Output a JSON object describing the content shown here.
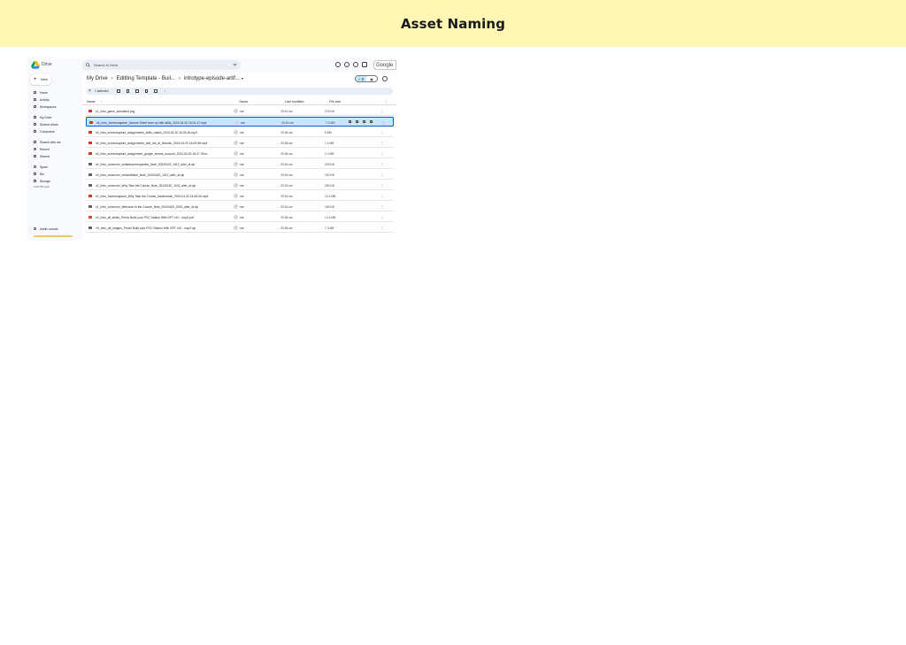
{
  "page": {
    "title": "Asset Naming"
  },
  "drive": {
    "app_name": "Drive",
    "search_placeholder": "Search in Drive",
    "account_label": "Google",
    "new_label": "New",
    "nav": [
      {
        "label": "Home",
        "icon": "home-icon"
      },
      {
        "label": "Activity",
        "icon": "activity-icon"
      },
      {
        "label": "Workspaces",
        "icon": "workspaces-icon"
      },
      {
        "label": "My Drive",
        "icon": "my-drive-icon"
      },
      {
        "label": "Shared drives",
        "icon": "shared-drives-icon"
      },
      {
        "label": "Computers",
        "icon": "computers-icon"
      },
      {
        "label": "Shared with me",
        "icon": "shared-with-me-icon"
      },
      {
        "label": "Recent",
        "icon": "recent-icon"
      },
      {
        "label": "Starred",
        "icon": "starred-icon"
      },
      {
        "label": "Spam",
        "icon": "spam-icon"
      },
      {
        "label": "Bin",
        "icon": "bin-icon"
      },
      {
        "label": "Storage",
        "icon": "storage-icon"
      }
    ],
    "storage_text": "5.69 TB used",
    "admin_label": "Admin console",
    "breadcrumb": {
      "root": "My Drive",
      "middle": "Editting Template - Buil...",
      "current": "introtype-episode-artif..."
    },
    "selection": {
      "count_label": "1 selected"
    },
    "view_toggle": {
      "list": "✓ ☰",
      "grid": "▦"
    },
    "columns": {
      "name": "Name",
      "owner": "Owner",
      "modified": "Last modified",
      "size": "File size"
    },
    "files": [
      {
        "name": "v1_intro_game_animation.png",
        "owner": "me",
        "modified": "20:51 me",
        "size": "276 KB",
        "type": "image",
        "color": "#d93025"
      },
      {
        "name": "v6_intro_Screencapture_Income Sheet level up with skills_2024-04-20 16-01-47.mp4",
        "owner": "me",
        "modified": "20:34 me",
        "size": "7.2 MB",
        "type": "video",
        "color": "#d93025",
        "selected": true
      },
      {
        "name": "v6_intro_screencapture_assignments_skills_matrix_2024-04-20 16-09-40.mp4",
        "owner": "me",
        "modified": "20:35 me",
        "size": "5 MB",
        "type": "video",
        "color": "#d93025"
      },
      {
        "name": "v6_intro_screencapture_assignments_add_me_at_linkedin_2024-04-20 16-09-38.mp4",
        "owner": "me",
        "modified": "20:35 me",
        "size": "1.2 MB",
        "type": "video",
        "color": "#d93025"
      },
      {
        "name": "v6_intro_screencapture_assignment_google_sheets_account_2024-04-20 16-07-09.m...",
        "owner": "me",
        "modified": "20:35 me",
        "size": "2.4 MB",
        "type": "video",
        "color": "#d93025"
      },
      {
        "name": "v4_intro_voiceover_whatareprerequisites_Note_20240422_1012_aiter_ai.zip",
        "owner": "me",
        "modified": "20:34 me",
        "size": "229 KB",
        "type": "zip",
        "color": "#5f6368"
      },
      {
        "name": "v3_intro_voiceover_whoshibdem_Note_20240422_1012_aiter_ai.zip",
        "owner": "me",
        "modified": "20:34 me",
        "size": "100 KB",
        "type": "zip",
        "color": "#5f6368"
      },
      {
        "name": "v2_intro_voiceover_Why Take the Course_Note_20240422_1001_aiter_ai.zip",
        "owner": "me",
        "modified": "20:33 me",
        "size": "253 KB",
        "type": "zip",
        "color": "#5f6368"
      },
      {
        "name": "v2_intro_Screencapture_Why Take the Course_trackerwork_2024-04-20 16-46-06.mp4",
        "owner": "me",
        "modified": "20:34 me",
        "size": "12.4 MB",
        "type": "video",
        "color": "#d93025"
      },
      {
        "name": "v1_intro_voiceover_Welcome to the Course_Note_20240422_0922_aiter_ai.zip",
        "owner": "me",
        "modified": "20:34 me",
        "size": "189 KB",
        "type": "zip",
        "color": "#5f6368"
      },
      {
        "name": "v0_intro_all_slides_Previz  Build your  POC Station With GPT v10 - mvp2.pdf",
        "owner": "me",
        "modified": "20:35 me",
        "size": "14.3 MB",
        "type": "pdf",
        "color": "#ea4335"
      },
      {
        "name": "V0_intro_all_images_Previz  Build your  POC Station With GPT v10 - mvp2.zip",
        "owner": "me",
        "modified": "20:35 me",
        "size": "7.3 MB",
        "type": "zip",
        "color": "#5f6368"
      }
    ]
  },
  "colors": {
    "banner": "#fff7b3",
    "selected_row": "#c2e7ff",
    "accent": "#0b57d0"
  }
}
